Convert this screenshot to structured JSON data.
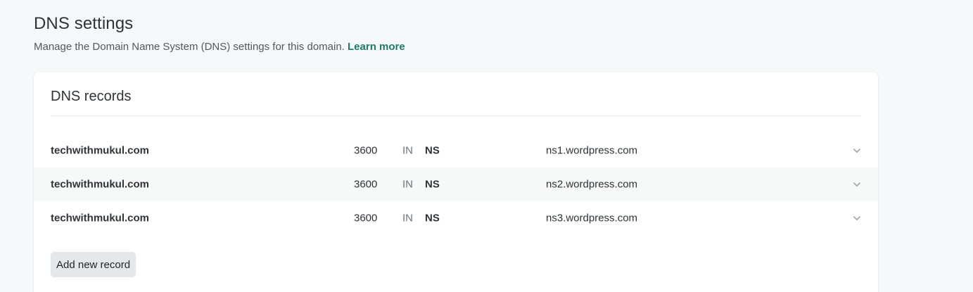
{
  "header": {
    "title": "DNS settings",
    "subtitle": "Manage the Domain Name System (DNS) settings for this domain.",
    "learn_more": "Learn more"
  },
  "card": {
    "title": "DNS records",
    "records": [
      {
        "domain": "techwithmukul.com",
        "ttl": "3600",
        "class": "IN",
        "type": "NS",
        "data": "ns1.wordpress.com"
      },
      {
        "domain": "techwithmukul.com",
        "ttl": "3600",
        "class": "IN",
        "type": "NS",
        "data": "ns2.wordpress.com"
      },
      {
        "domain": "techwithmukul.com",
        "ttl": "3600",
        "class": "IN",
        "type": "NS",
        "data": "ns3.wordpress.com"
      }
    ],
    "add_button": "Add new record"
  },
  "icons": {
    "expand": "chevron-down-icon"
  },
  "colors": {
    "accent_link": "#1f7a6b",
    "page_background": "#f6f9f9",
    "card_background": "#ffffff",
    "row_alt_background": "#f7f8f8",
    "button_background": "#e5e8ea"
  }
}
